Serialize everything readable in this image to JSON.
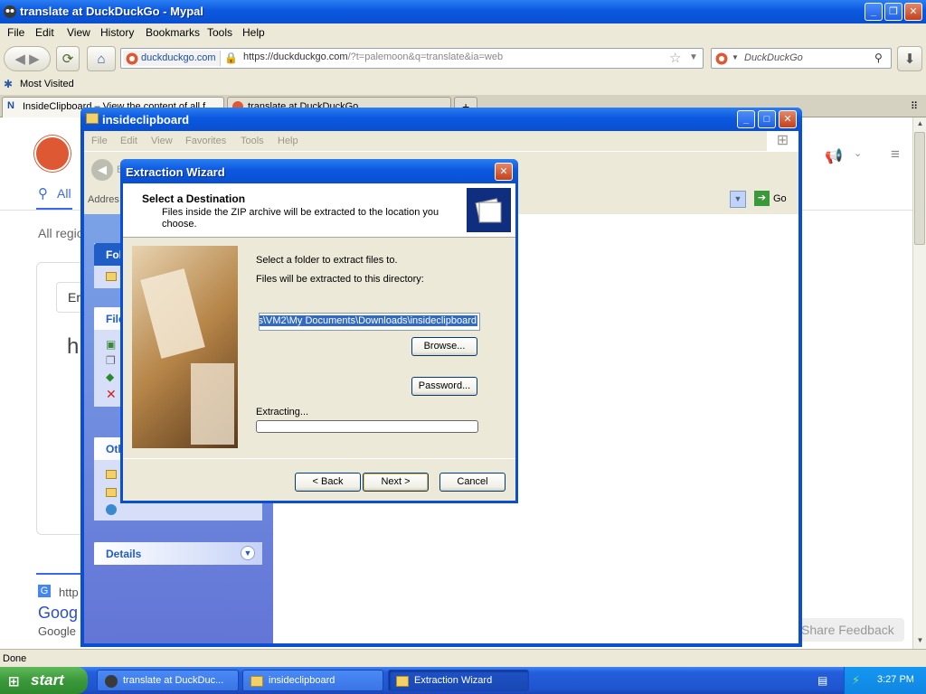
{
  "browser": {
    "title": "translate at DuckDuckGo - Mypal",
    "menu": [
      "File",
      "Edit",
      "View",
      "History",
      "Bookmarks",
      "Tools",
      "Help"
    ],
    "identity": "duckduckgo.com",
    "url_prefix": "https://duckduckgo.com",
    "url_rest": "/?t=palemoon&q=translate&ia=web",
    "search_placeholder": "DuckDuckGo",
    "bookmarks": [
      "Most Visited"
    ],
    "tabs": [
      "InsideClipboard – View the content of all f",
      "translate at DuckDuckGo"
    ],
    "status": "Done"
  },
  "page": {
    "all_tab": "All",
    "regions": "All regio",
    "search_snip": "Er",
    "big_h": "h",
    "result_url": "http",
    "result_title": "Goog",
    "result_source": "Google",
    "share_feedback": "Share Feedback"
  },
  "explorer": {
    "title": "insideclipboard",
    "menu": [
      "File",
      "Edit",
      "View",
      "Favorites",
      "Tools",
      "Help"
    ],
    "back": "B",
    "address_label": "Addres",
    "go": "Go",
    "folder_tasks_head": "Fol",
    "file_tasks_head": "File",
    "other_head": "Oth",
    "details_head": "Details"
  },
  "dialog": {
    "title": "Extraction Wizard",
    "heading": "Select a Destination",
    "subheading": "Files inside the ZIP archive will be extracted to the location you choose.",
    "select_label": "Select a folder to extract files to.",
    "dir_label": "Files will be extracted to this directory:",
    "dir_value": "s\\VM2\\My Documents\\Downloads\\insideclipboard",
    "browse": "Browse...",
    "password": "Password...",
    "extracting": "Extracting...",
    "progress": 0,
    "back": "< Back",
    "next": "Next >",
    "cancel": "Cancel"
  },
  "taskbar": {
    "start": "start",
    "tasks": [
      "translate at DuckDuc...",
      "insideclipboard",
      "Extraction Wizard"
    ],
    "clock": "3:27 PM"
  },
  "colors": {
    "xp_blue": "#0a4fd0",
    "task_pane": "#6375d6",
    "start_green": "#3a993a"
  }
}
